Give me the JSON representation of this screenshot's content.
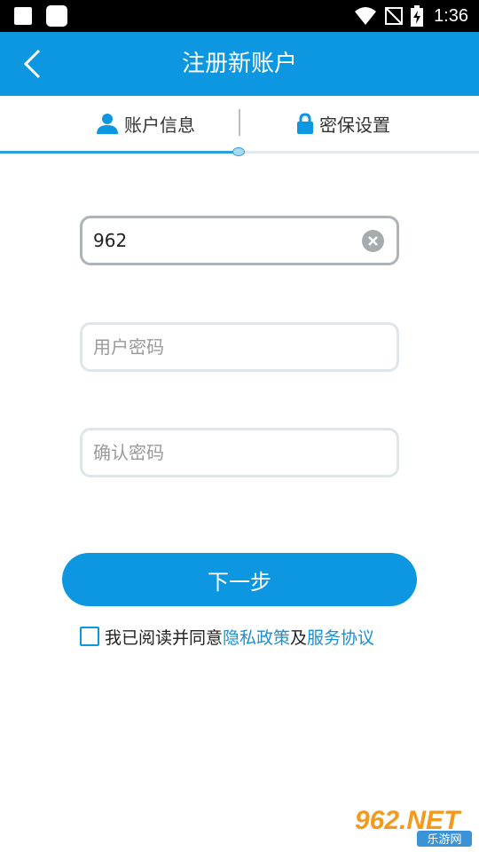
{
  "status_bar": {
    "time": "1:36"
  },
  "header": {
    "title": "注册新账户"
  },
  "tabs": [
    {
      "label": "账户信息",
      "icon": "user-icon",
      "active": true
    },
    {
      "label": "密保设置",
      "icon": "lock-icon",
      "active": false
    }
  ],
  "form": {
    "account": {
      "value": "962",
      "placeholder": ""
    },
    "password": {
      "value": "",
      "placeholder": "用户密码"
    },
    "confirm_password": {
      "value": "",
      "placeholder": "确认密码"
    }
  },
  "next_button": {
    "label": "下一步"
  },
  "agreement": {
    "prefix": "我已阅读并同意",
    "privacy_link": "隐私政策",
    "conjunction": "及",
    "service_link": "服务协议",
    "checked": false
  },
  "watermark": {
    "brand": "962.NET",
    "sub": "乐游网"
  },
  "colors": {
    "primary": "#0d97e0",
    "link": "#1a8fd1",
    "status_bar": "#000000"
  }
}
